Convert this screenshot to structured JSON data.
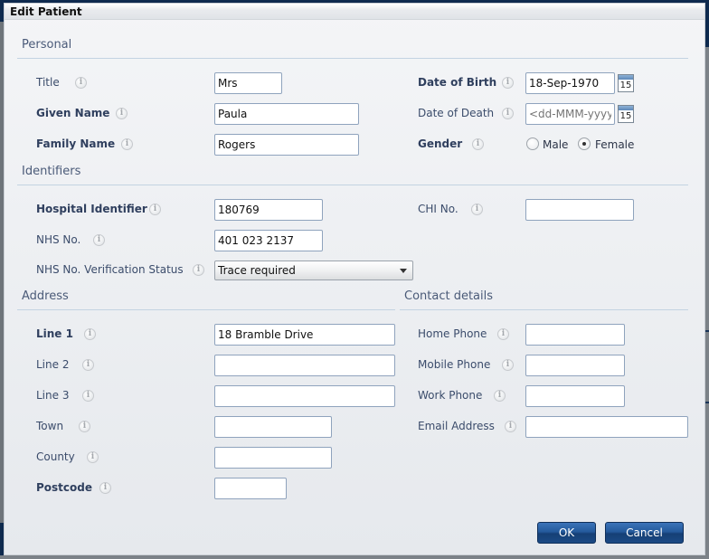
{
  "dialog": {
    "title": "Edit Patient"
  },
  "sections": {
    "personal": "Personal",
    "identifiers": "Identifiers",
    "address": "Address",
    "contact": "Contact details"
  },
  "personal": {
    "title": {
      "label": "Title",
      "value": "Mrs"
    },
    "given_name": {
      "label": "Given Name",
      "value": "Paula"
    },
    "family_name": {
      "label": "Family Name",
      "value": "Rogers"
    },
    "date_of_birth": {
      "label": "Date of Birth",
      "value": "18-Sep-1970"
    },
    "date_of_death": {
      "label": "Date of Death",
      "value": "",
      "placeholder": "<dd-MMM-yyyy>"
    },
    "calendar_day": "15",
    "gender": {
      "label": "Gender",
      "options": [
        {
          "label": "Male",
          "checked": false
        },
        {
          "label": "Female",
          "checked": true
        }
      ]
    }
  },
  "identifiers": {
    "hospital_identifier": {
      "label": "Hospital Identifier",
      "value": "180769"
    },
    "chi_no": {
      "label": "CHI No.",
      "value": ""
    },
    "nhs_no": {
      "label": "NHS No.",
      "value": "401 023 2137"
    },
    "nhs_verification": {
      "label": "NHS No. Verification Status",
      "value": "Trace required"
    }
  },
  "address": {
    "line1": {
      "label": "Line 1",
      "value": "18 Bramble Drive"
    },
    "line2": {
      "label": "Line 2",
      "value": ""
    },
    "line3": {
      "label": "Line 3",
      "value": ""
    },
    "town": {
      "label": "Town",
      "value": ""
    },
    "county": {
      "label": "County",
      "value": ""
    },
    "postcode": {
      "label": "Postcode",
      "value": ""
    }
  },
  "contact": {
    "home_phone": {
      "label": "Home Phone",
      "value": ""
    },
    "mobile_phone": {
      "label": "Mobile Phone",
      "value": ""
    },
    "work_phone": {
      "label": "Work Phone",
      "value": ""
    },
    "email": {
      "label": "Email Address",
      "value": ""
    }
  },
  "buttons": {
    "ok": "OK",
    "cancel": "Cancel"
  },
  "icons": {
    "info": "i"
  },
  "colors": {
    "button_primary": "#245a9c",
    "section_rule": "#c3d3e2",
    "field_border": "#8fa3bd",
    "label_text": "#3b4c6b"
  }
}
